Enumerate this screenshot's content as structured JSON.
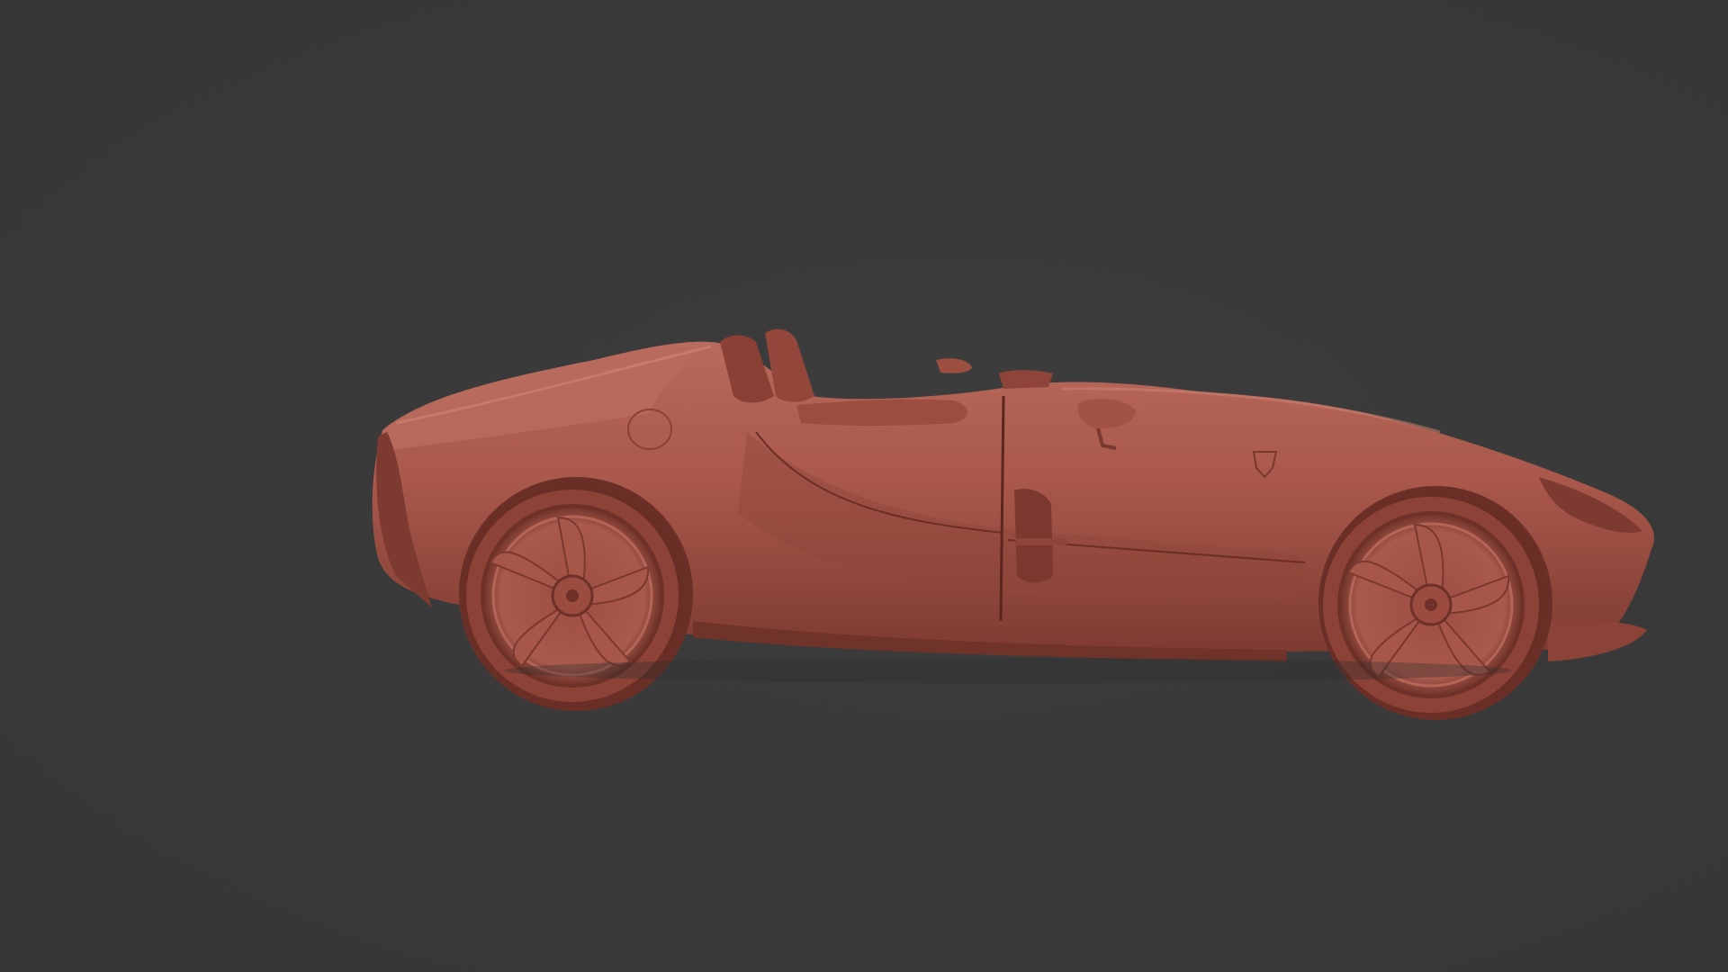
{
  "viewport": {
    "background": "#393939",
    "model_color": "#a9584b",
    "model_shadow": "#5e2a22",
    "model_highlight": "#c97a6b"
  }
}
